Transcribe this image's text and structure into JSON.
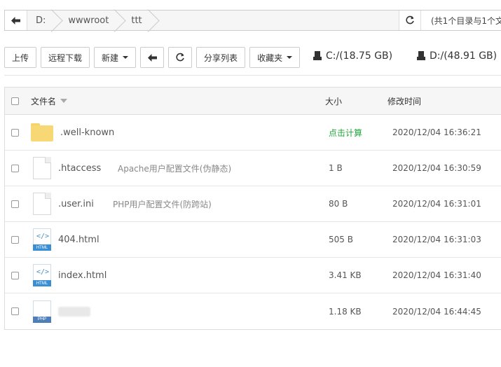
{
  "breadcrumb": {
    "items": [
      "D:",
      "wwwroot",
      "ttt"
    ],
    "status": "(共1个目录与1个文"
  },
  "toolbar": {
    "upload": "上传",
    "remote_download": "远程下载",
    "new": "新建",
    "share_list": "分享列表",
    "favorites": "收藏夹"
  },
  "disks": [
    {
      "label": "C:/(18.75 GB)"
    },
    {
      "label": "D:/(48.91 GB)"
    }
  ],
  "table": {
    "headers": {
      "name": "文件名",
      "size": "大小",
      "time": "修改时间"
    },
    "rows": [
      {
        "name": ".well-known",
        "desc": "",
        "size": "点击计算",
        "time": "2020/12/04 16:36:21",
        "icon": "folder-icon"
      },
      {
        "name": ".htaccess",
        "desc": "Apache用户配置文件(伪静态)",
        "size": "1 B",
        "time": "2020/12/04 16:30:59",
        "icon": "file-icon"
      },
      {
        "name": ".user.ini",
        "desc": "PHP用户配置文件(防跨站)",
        "size": "80 B",
        "time": "2020/12/04 16:31:01",
        "icon": "file-icon"
      },
      {
        "name": "404.html",
        "desc": "",
        "size": "505 B",
        "time": "2020/12/04 16:31:03",
        "icon": "html-file-icon"
      },
      {
        "name": "index.html",
        "desc": "",
        "size": "3.41 KB",
        "time": "2020/12/04 16:31:40",
        "icon": "html-file-icon"
      },
      {
        "name": "",
        "desc": "",
        "size": "1.18 KB",
        "time": "2020/12/04 16:44:45",
        "icon": "php-file-icon"
      }
    ]
  },
  "icon_badges": {
    "html": "HTML",
    "php": "PHP",
    "code": "</>"
  },
  "colors": {
    "calc_link": "#20a53a",
    "folder": "#f8d775",
    "badge": "#3a8fd4"
  }
}
